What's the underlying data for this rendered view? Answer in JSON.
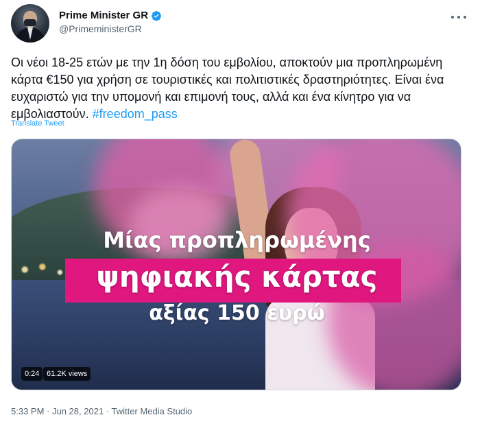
{
  "author": {
    "display_name": "Prime Minister GR",
    "handle": "@PrimeministerGR",
    "verified": true
  },
  "tweet": {
    "text_main": "Οι νέοι 18-25 ετών με την 1η δόση του εμβολίου, αποκτούν μια προπληρωμένη κάρτα €150 για χρήση σε τουριστικές και πολιτιστικές δραστηριότητες. Είναι ένα ευχαριστώ για την υπομονή και επιμονή τους, αλλά και ένα κίνητρο για να εμβολιαστούν.",
    "hashtag": "#freedom_pass",
    "translate_label": "Translate Tweet"
  },
  "media": {
    "caption_line1": "Μίας προπληρωμένης",
    "caption_line2": "ψηφιακής κάρτας",
    "caption_line3": "αξίας 150 ευρώ",
    "duration": "0:24",
    "views": "61.2K views",
    "highlight_color": "#e0177f"
  },
  "meta": {
    "time": "5:33 PM",
    "separator1": " · ",
    "date": "Jun 28, 2021",
    "separator2": " · ",
    "source": "Twitter Media Studio"
  },
  "icons": {
    "verified": "verified-badge-icon",
    "more": "more-options-icon"
  },
  "colors": {
    "link": "#1d9bf0",
    "verified": "#1d9bf0",
    "secondary_text": "#536471"
  }
}
